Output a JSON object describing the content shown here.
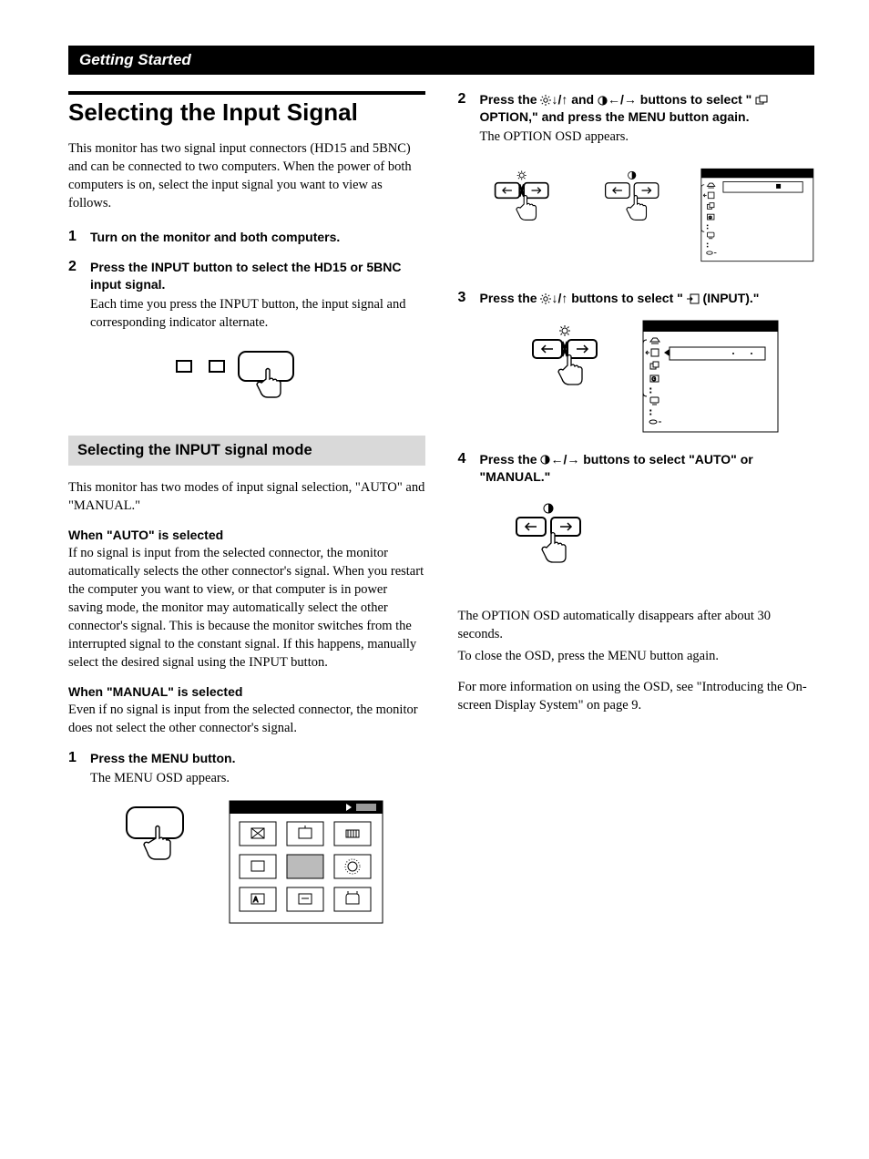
{
  "header": {
    "section": "Getting Started"
  },
  "title": "Selecting the Input Signal",
  "intro": "This monitor has two signal input connectors (HD15 and 5BNC) and can be connected to two computers. When the power of both computers is on, select the input signal you want to view as follows.",
  "left_steps": {
    "s1": {
      "head": "Turn on the monitor and both computers."
    },
    "s2": {
      "head": "Press the INPUT button to select the HD15 or 5BNC input signal.",
      "body": "Each time you press the INPUT button, the input signal and corresponding indicator alternate."
    }
  },
  "sub_heading": "Selecting the INPUT signal mode",
  "sub_intro": "This monitor has two modes of input signal selection, \"AUTO\" and \"MANUAL.\"",
  "auto_head": "When \"AUTO\" is selected",
  "auto_body": "If no signal is input from the selected connector, the monitor automatically selects the other connector's signal. When you restart the computer you want to view, or that computer is in power saving mode, the monitor may automatically select the other connector's signal.  This is because the monitor switches from the interrupted signal to the constant signal. If this happens, manually select the desired signal using the INPUT button.",
  "manual_head": "When \"MANUAL\" is selected",
  "manual_body": "Even if no signal is input from the selected connector, the monitor does not select the other connector's signal.",
  "manual_steps": {
    "s1": {
      "head": "Press the MENU button.",
      "body": "The MENU OSD appears."
    }
  },
  "col2": {
    "s2": {
      "head_pre": "Press the ",
      "head_mid": " and ",
      "head_post": " buttons to select \" ",
      "head_tail": " OPTION,\" and press the MENU button again.",
      "body": "The OPTION OSD appears."
    },
    "s3": {
      "head_pre": "Press the ",
      "head_post": " buttons to select \" ",
      "head_tail": " (INPUT).\""
    },
    "s4": {
      "head_pre": "Press the ",
      "head_post": " buttons to select \"AUTO\" or \"MANUAL.\""
    },
    "closing1": "The OPTION OSD automatically disappears after about 30 seconds.",
    "closing2": "To close the OSD, press the MENU button again.",
    "closing3": "For more information on using the OSD, see \"Introducing the On-screen Display System\" on page 9."
  },
  "glyphs": {
    "downup": "↓/↑",
    "leftright": "←/→"
  }
}
